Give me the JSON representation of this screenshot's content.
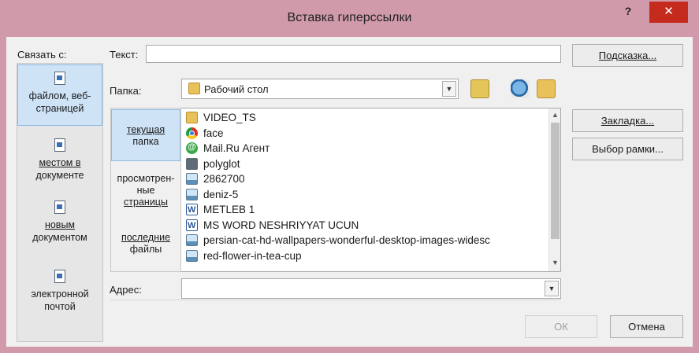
{
  "dialog": {
    "title": "Вставка гиперссылки",
    "help_label": "?",
    "close_label": "✕"
  },
  "link_to": {
    "label": "Связать с:",
    "items": [
      {
        "label_line1": "файлом, веб-",
        "label_line2": "страницей",
        "selected": true,
        "icon": "web-page-icon"
      },
      {
        "label_line1": "местом в",
        "label_line2": "документе",
        "selected": false,
        "icon": "place-in-document-icon"
      },
      {
        "label_line1": "новым",
        "label_line2": "документом",
        "selected": false,
        "icon": "new-document-icon"
      },
      {
        "label_line1": "электронной",
        "label_line2": "почтой",
        "selected": false,
        "icon": "email-icon"
      }
    ]
  },
  "text_field": {
    "label": "Текст:",
    "value": ""
  },
  "buttons": {
    "hint": "Подсказка...",
    "bookmark": "Закладка...",
    "frame": "Выбор рамки...",
    "ok": "ОК",
    "cancel": "Отмена"
  },
  "folder": {
    "label": "Папка:",
    "value": "Рабочий стол"
  },
  "tabs": [
    {
      "line1": "текущая",
      "line2": "папка",
      "line3": "",
      "selected": true
    },
    {
      "line1": "просмотрен-",
      "line2": "ные",
      "line3": "страницы",
      "selected": false
    },
    {
      "line1": "последние",
      "line2": "файлы",
      "line3": "",
      "selected": false
    }
  ],
  "files": [
    {
      "name": "VIDEO_TS",
      "icon": "folder"
    },
    {
      "name": "face",
      "icon": "chrome"
    },
    {
      "name": "Mail.Ru Агент",
      "icon": "mail"
    },
    {
      "name": "polyglot",
      "icon": "app"
    },
    {
      "name": "2862700",
      "icon": "img"
    },
    {
      "name": "deniz-5",
      "icon": "img"
    },
    {
      "name": "METLEB 1",
      "icon": "word"
    },
    {
      "name": "MS WORD NESHRIYYAT UCUN",
      "icon": "word"
    },
    {
      "name": "persian-cat-hd-wallpapers-wonderful-desktop-images-widesc",
      "icon": "img"
    },
    {
      "name": "red-flower-in-tea-cup",
      "icon": "img"
    }
  ],
  "address": {
    "label": "Адрес:",
    "value": ""
  }
}
